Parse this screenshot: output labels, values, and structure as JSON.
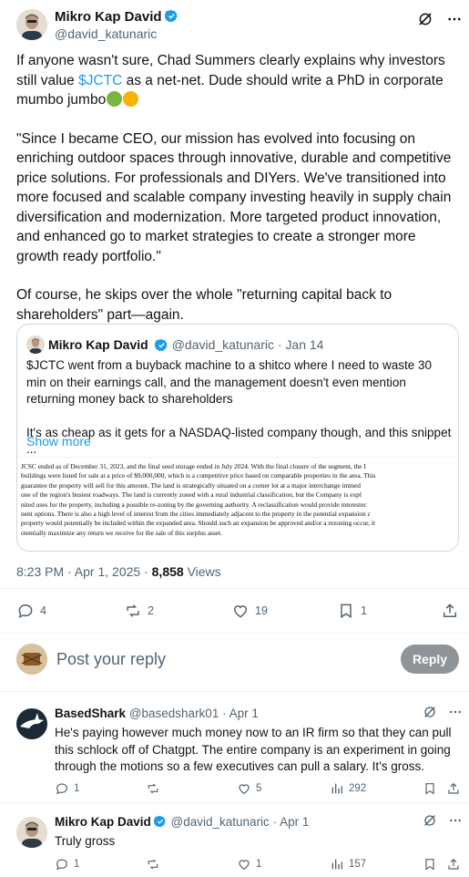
{
  "tweet": {
    "author_name": "Mikro Kap David",
    "author_handle": "@david_katunaric",
    "text_1_pre": "If anyone wasn't sure, Chad Summers clearly explains why investors still value ",
    "cashtag": "$JCTC",
    "text_1_post": " as a net-net. Dude should write a PhD in corporate mumbo jumbo",
    "text_2": "\"Since I became CEO, our mission has evolved into focusing on enriching outdoor spaces through innovative, durable and competitive price solutions. For professionals and DIYers. We've transitioned into more focused and scalable company investing heavily in supply chain diversification and modernization. More targeted product innovation, and enhanced go to market strategies to create a stronger more growth ready portfolio.\"",
    "text_3": "Of course, he skips over the whole \"returning capital back to shareholders\" part—again.",
    "time": "8:23 PM · Apr 1, 2025 · ",
    "views_count": "8,858",
    "views_label": " Views",
    "stats": {
      "replies": "4",
      "reposts": "2",
      "likes": "19",
      "bookmarks": "1"
    }
  },
  "quote": {
    "author_name": "Mikro Kap David",
    "author_handle": "@david_katunaric · Jan 14",
    "text_1": "$JCTC went from a buyback machine to a shitco where I need to waste 30 min on their earnings call, and the management doesn't even mention returning money back to shareholders",
    "text_2": "It's as cheap as it gets for a NASDAQ-listed company though, and this snippet ...",
    "show_more": "Show more",
    "doc_lines": [
      "JCSC ended as of December 31, 2023, and the final seed storage ended in July 2024. With the final closure of the segment, the I",
      " buildings were listed for sale at a price of $9,000,000, which is a competitive price based on comparable properties in the area. This",
      " guarantee the property will sell for this amount. The land is strategically situated on a corner lot at a major interchange immed",
      "  one of the region's busiest roadways. The land is currently zoned with a rural industrial classification, but the Company is expl",
      "nited uses for the property, including a possible re-zoning by the governing authority. A reclassification would provide interestec",
      "nent options. There is also a high level of interest from the cities immediately adjacent to the property in the potential expansion c",
      "property would potentially be included within the expanded area. Should such an expansion be approved and/or a rezoning occur, it",
      "otentially maximize any return we receive for the sale of this surplus asset."
    ]
  },
  "composer": {
    "placeholder": "Post your reply",
    "button": "Reply"
  },
  "replies": [
    {
      "author_name": "BasedShark",
      "author_handle": "@basedshark01 · Apr 1",
      "text": "He's paying however much money now to an IR firm so that they can pull this schlock off of Chatgpt.  The entire company is an experiment in going through the motions so a few executives can pull a salary.  It's gross.",
      "stats": {
        "replies": "1",
        "reposts": "",
        "likes": "5",
        "views": "292"
      }
    },
    {
      "author_name": "Mikro Kap David",
      "author_handle": "@david_katunaric · Apr 1",
      "text": "Truly gross",
      "stats": {
        "replies": "1",
        "reposts": "",
        "likes": "1",
        "views": "157"
      }
    }
  ],
  "colors": {
    "accent": "#1d9bf0",
    "text": "#0f1419",
    "muted": "#536471",
    "border": "#cfd9de",
    "reply_button": "#8f9499"
  },
  "icons": [
    "grok-icon",
    "more-icon",
    "verified-badge-icon",
    "reply-icon",
    "repost-icon",
    "like-icon",
    "bookmark-icon",
    "share-icon",
    "views-icon"
  ]
}
